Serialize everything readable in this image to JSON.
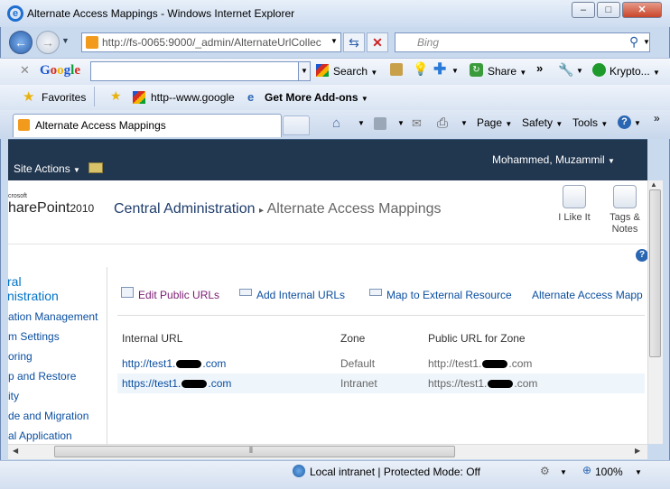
{
  "window": {
    "title": "Alternate Access Mappings - Windows Internet Explorer"
  },
  "nav": {
    "address": "http://fs-0065:9000/_admin/AlternateUrlCollec",
    "search_placeholder": "Bing"
  },
  "toolbar": {
    "google_logo": "Google",
    "search_label": "Search",
    "share_label": "Share",
    "krypto_label": "Krypto..."
  },
  "favorites": {
    "favorites_label": "Favorites",
    "items": [
      "http--www.google",
      "Get More Add-ons"
    ]
  },
  "tab": {
    "title": "Alternate Access Mappings"
  },
  "commandbar": {
    "page": "Page",
    "safety": "Safety",
    "tools": "Tools"
  },
  "sharepoint": {
    "site_actions": "Site Actions",
    "user": "Mohammed, Muzammil",
    "logo_micro": "crosoft",
    "logo_text": "harePoint",
    "logo_version": "2010",
    "breadcrumb_root": "Central Administration",
    "breadcrumb_page": "Alternate Access Mappings",
    "i_like_it": "I Like It",
    "tags_notes_1": "Tags &",
    "tags_notes_2": "Notes"
  },
  "leftnav": {
    "heading_1": "ral",
    "heading_2": "nistration",
    "items": [
      "ation Management",
      "m Settings",
      "oring",
      "p and Restore",
      "ity",
      "de and Migration",
      "al Application"
    ]
  },
  "actions": [
    "Edit Public URLs",
    "Add Internal URLs",
    "Map to External Resource",
    "Alternate Access Mapp"
  ],
  "table": {
    "headers": [
      "Internal URL",
      "Zone",
      "Public URL for Zone"
    ],
    "rows": [
      {
        "internal_prefix": "http://test1.",
        "internal_suffix": ".com",
        "zone": "Default",
        "public_prefix": "http://test1.",
        "public_suffix": ".com"
      },
      {
        "internal_prefix": "https://test1.",
        "internal_suffix": ".com",
        "zone": "Intranet",
        "public_prefix": "https://test1.",
        "public_suffix": ".com"
      }
    ]
  },
  "status": {
    "zone": "Local intranet | Protected Mode: Off",
    "zoom": "100%"
  },
  "colors": {
    "ribbon": "#21364f",
    "link": "#0b4fa0",
    "visited_action": "#7a1b72"
  }
}
